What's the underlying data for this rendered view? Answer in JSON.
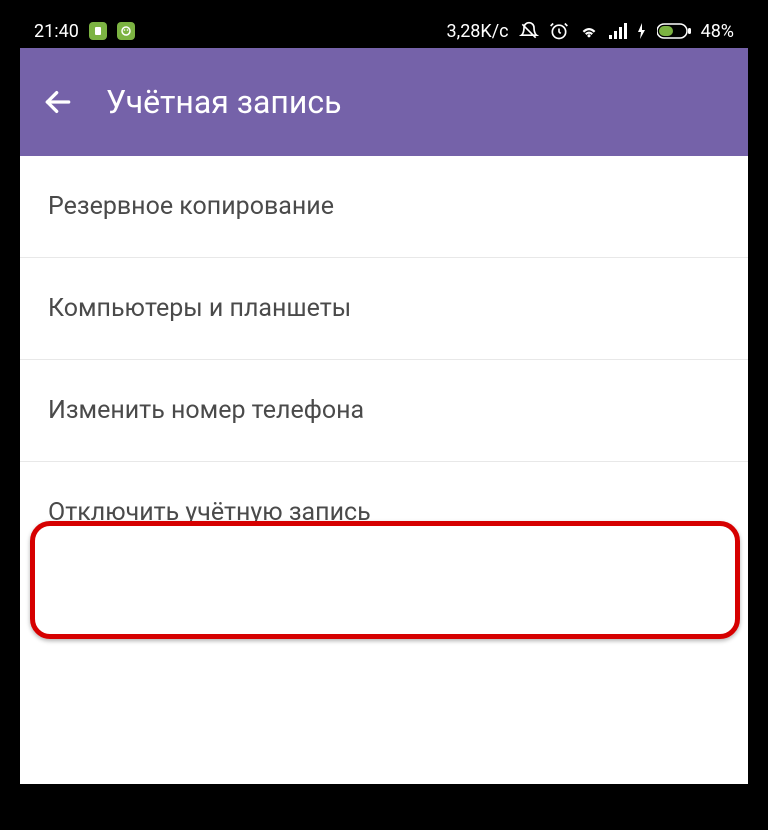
{
  "status": {
    "time": "21:40",
    "net_speed": "3,28K/c",
    "battery_pct": "48%"
  },
  "appbar": {
    "title": "Учётная запись"
  },
  "items": [
    {
      "label": "Резервное копирование"
    },
    {
      "label": "Компьютеры и планшеты"
    },
    {
      "label": "Изменить номер телефона"
    },
    {
      "label": "Отключить учётную запись"
    }
  ],
  "colors": {
    "appbar": "#7562a9",
    "highlight": "#d60000",
    "badge": "#7cb342"
  }
}
